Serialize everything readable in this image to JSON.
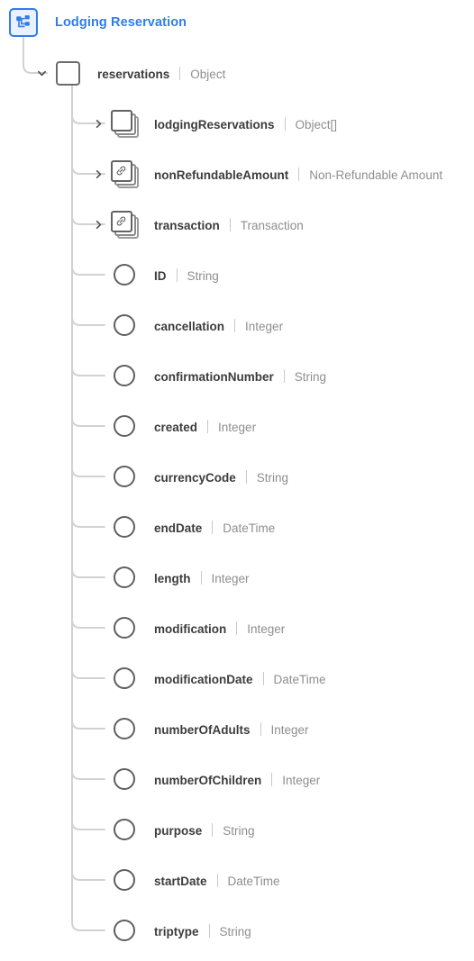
{
  "header": {
    "icon": "sitemap-icon",
    "title": "Lodging Reservation",
    "accent_color": "#2f7ced"
  },
  "tree": {
    "root": {
      "name": "reservations",
      "type": "Object",
      "glyph": "square",
      "expanded": true,
      "chevron": "chevron-down-icon"
    },
    "children": [
      {
        "name": "lodgingReservations",
        "type": "Object[]",
        "glyph": "stack",
        "chevron": "chevron-right-icon",
        "expandable": true
      },
      {
        "name": "nonRefundableAmount",
        "type": "Non-Refundable Amount",
        "glyph": "stack-link",
        "chevron": "chevron-right-icon",
        "expandable": true
      },
      {
        "name": "transaction",
        "type": "Transaction",
        "glyph": "stack-link",
        "chevron": "chevron-right-icon",
        "expandable": true
      },
      {
        "name": "ID",
        "type": "String",
        "glyph": "circle",
        "expandable": false
      },
      {
        "name": "cancellation",
        "type": "Integer",
        "glyph": "circle",
        "expandable": false
      },
      {
        "name": "confirmationNumber",
        "type": "String",
        "glyph": "circle",
        "expandable": false
      },
      {
        "name": "created",
        "type": "Integer",
        "glyph": "circle",
        "expandable": false
      },
      {
        "name": "currencyCode",
        "type": "String",
        "glyph": "circle",
        "expandable": false
      },
      {
        "name": "endDate",
        "type": "DateTime",
        "glyph": "circle",
        "expandable": false
      },
      {
        "name": "length",
        "type": "Integer",
        "glyph": "circle",
        "expandable": false
      },
      {
        "name": "modification",
        "type": "Integer",
        "glyph": "circle",
        "expandable": false
      },
      {
        "name": "modificationDate",
        "type": "DateTime",
        "glyph": "circle",
        "expandable": false
      },
      {
        "name": "numberOfAdults",
        "type": "Integer",
        "glyph": "circle",
        "expandable": false
      },
      {
        "name": "numberOfChildren",
        "type": "Integer",
        "glyph": "circle",
        "expandable": false
      },
      {
        "name": "purpose",
        "type": "String",
        "glyph": "circle",
        "expandable": false
      },
      {
        "name": "startDate",
        "type": "DateTime",
        "glyph": "circle",
        "expandable": false
      },
      {
        "name": "triptype",
        "type": "String",
        "glyph": "circle",
        "expandable": false
      }
    ]
  },
  "style": {
    "line_color": "#d2d2d2",
    "label_color": "#3c3c3c",
    "type_color": "#8e8e8e"
  }
}
